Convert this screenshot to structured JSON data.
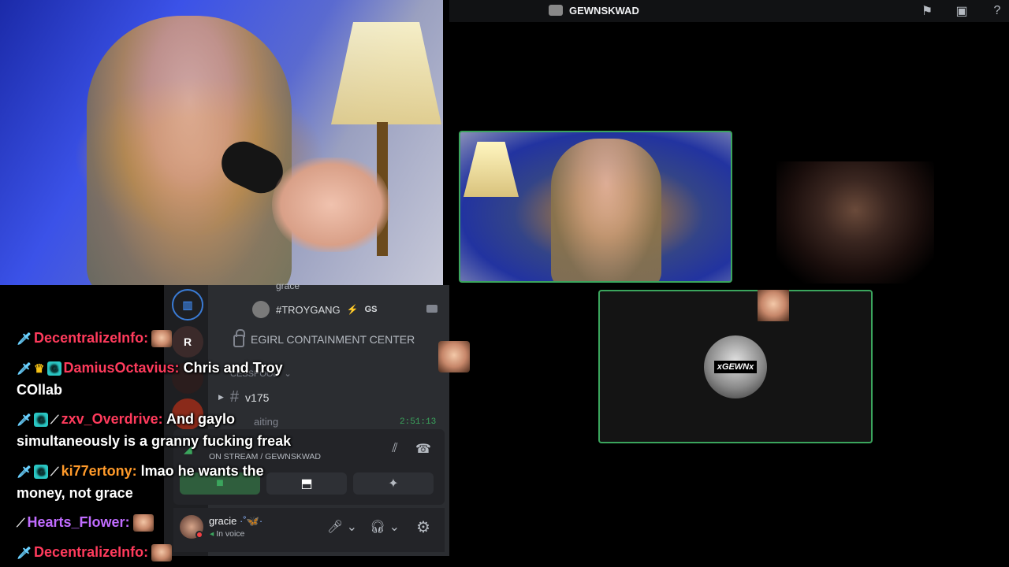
{
  "discord": {
    "server_title": "GEWNSKWAD",
    "channels": {
      "partial_name": "grace",
      "voice_user": "#TROYGANG",
      "voice_user_tag": "GS",
      "locked_channel": "EGIRL CONTAINMENT CENTER",
      "category": "CESSPOOL",
      "text_channel": "v175",
      "waiting_partial": "aiting",
      "timer": "2:51:13"
    },
    "voice_panel": {
      "status": "ON STREAM / GEWNSKWAD"
    },
    "user": {
      "name": "gracie",
      "status": "In voice"
    },
    "avatar_logo_text": "xGEWNx",
    "server_letter": "R"
  },
  "chat": {
    "messages": [
      {
        "user": "DecentralizeInfo:",
        "text": "",
        "color": "#ff3b5c"
      },
      {
        "user": "DamiusOctavius:",
        "text": "Chris and Troy",
        "cont": "COllab",
        "color": "#ff3b5c"
      },
      {
        "user": "zxv_Overdrive:",
        "text": "And gaylo",
        "cont": "simultaneously is a granny fucking freak",
        "color": "#ff3b5c"
      },
      {
        "user": "ki77ertony:",
        "text": "lmao he wants the",
        "cont": "money, not grace",
        "color": "#ff9a2a"
      },
      {
        "user": "Hearts_Flower:",
        "text": "",
        "color": "#c06cff"
      },
      {
        "user": "DecentralizeInfo:",
        "text": "",
        "color": "#ff3b5c"
      }
    ]
  },
  "colors": {
    "speaking_border": "#3ba55d",
    "discord_bg": "#2b2d31"
  }
}
